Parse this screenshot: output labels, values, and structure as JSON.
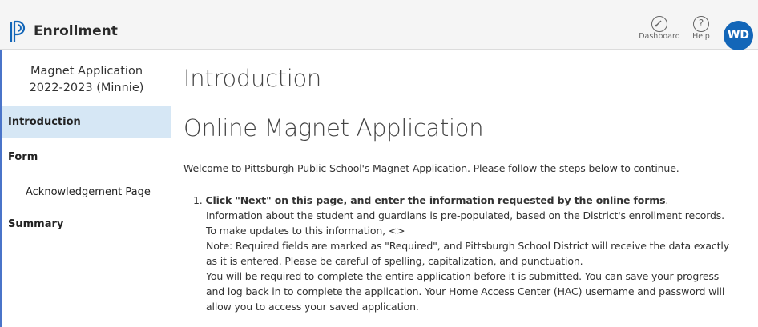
{
  "header": {
    "app_title": "Enrollment",
    "dashboard_label": "Dashboard",
    "help_label": "Help",
    "help_glyph": "?",
    "avatar_initials": "WD",
    "colors": {
      "brand": "#1366b8",
      "avatar_bg": "#1366b8",
      "frame": "#4a74c9"
    }
  },
  "sidebar": {
    "title_line1": "Magnet Application",
    "title_line2": "2022-2023 (Minnie)",
    "items": [
      {
        "label": "Introduction",
        "active": true
      },
      {
        "label": "Form",
        "active": false
      },
      {
        "label": "Acknowledgement Page",
        "active": false
      },
      {
        "label": "Summary",
        "active": false
      }
    ],
    "active_color": "#d6e7f5"
  },
  "main": {
    "heading": "Introduction",
    "subheading": "Online Magnet Application",
    "welcome": "Welcome to Pittsburgh Public School's Magnet Application.  Please follow the steps below to continue.",
    "step1": {
      "number": "1.",
      "bold": "Click \"Next\" on this page, and enter the information requested by the online forms",
      "bold_suffix": ".",
      "lines": [
        "Information about the student and guardians is pre-populated, based on the District's enrollment records.",
        "To make updates to this information, <>",
        "Note: Required fields are marked as \"Required\", and Pittsburgh School District will receive the data exactly",
        "as it is entered.  Please be careful of spelling, capitalization, and punctuation.",
        "You will be required to complete the entire application before it is submitted. You can save your progress",
        "and log back in to complete the application. Your Home Access Center (HAC) username and password will",
        "allow you to access your saved application."
      ]
    }
  }
}
